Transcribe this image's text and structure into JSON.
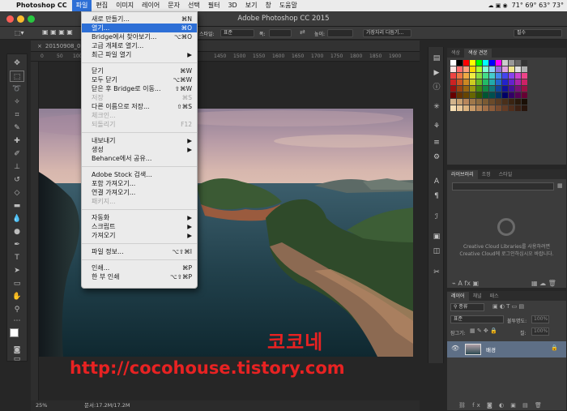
{
  "macbar": {
    "app_name": "Photoshop CC",
    "menus": [
      "파일",
      "편집",
      "이미지",
      "레이어",
      "문자",
      "선택",
      "필터",
      "3D",
      "보기",
      "창",
      "도움말"
    ],
    "status": "71°  69°  63°  73°"
  },
  "window": {
    "title": "Adobe Photoshop CC 2015"
  },
  "options": {
    "style_label": "스타일:",
    "style_value": "표준",
    "width_label": "폭:",
    "height_label": "높이:",
    "select_mask": "가장자리 다듬기...",
    "workspace": "필수"
  },
  "document": {
    "tab": "20150908_09",
    "ruler_ticks": [
      "0",
      "50",
      "100",
      "1450",
      "1500",
      "1550",
      "1600",
      "1650",
      "1700",
      "1750",
      "1800",
      "1850",
      "1900",
      "1950",
      "2000",
      "2050",
      "2100"
    ]
  },
  "statusbar": {
    "zoom": "25%",
    "doc_info": "문서:17.2M/17.2M"
  },
  "watermark": {
    "name": "코코네",
    "url": "http://cocohouse.tistory.com"
  },
  "swatches": {
    "tabs": [
      "색상",
      "색상 견본"
    ]
  },
  "libraries": {
    "tabs": [
      "라이브러리",
      "조정",
      "스타일"
    ],
    "message_line1": "Creative Cloud Libraries를 사용하려면",
    "message_line2": "Creative Cloud에 로그인하십시오 바랍니다."
  },
  "layers": {
    "tabs": [
      "레이어",
      "채널",
      "패스"
    ],
    "filter": "종류",
    "blend": "표준",
    "opacity_label": "불투명도:",
    "opacity": "100%",
    "lock_label": "잠그기:",
    "fill_label": "칠:",
    "fill": "100%",
    "layer_name": "배경"
  },
  "file_menu": {
    "items": [
      {
        "label": "새로 만들기...",
        "shortcut": "⌘N"
      },
      {
        "label": "열기...",
        "shortcut": "⌘O",
        "selected": true
      },
      {
        "label": "Bridge에서 찾아보기...",
        "shortcut": "⌥⌘O"
      },
      {
        "label": "고급 개체로 열기...",
        "shortcut": ""
      },
      {
        "label": "최근 파일 열기",
        "shortcut": "▶"
      },
      {
        "label": "닫기",
        "shortcut": "⌘W"
      },
      {
        "label": "모두 닫기",
        "shortcut": "⌥⌘W"
      },
      {
        "label": "닫은 후 Bridge로 이동...",
        "shortcut": "⇧⌘W"
      },
      {
        "label": "저장",
        "shortcut": "⌘S",
        "disabled": true
      },
      {
        "label": "다른 이름으로 저장...",
        "shortcut": "⇧⌘S"
      },
      {
        "label": "체크인...",
        "shortcut": "",
        "disabled": true
      },
      {
        "label": "되돌리기",
        "shortcut": "F12",
        "disabled": true
      },
      {
        "label": "내보내기",
        "shortcut": "▶"
      },
      {
        "label": "생성",
        "shortcut": "▶"
      },
      {
        "label": "Behance에서 공유...",
        "shortcut": ""
      },
      {
        "label": "Adobe Stock 검색...",
        "shortcut": ""
      },
      {
        "label": "포함 가져오기...",
        "shortcut": ""
      },
      {
        "label": "연결 가져오기...",
        "shortcut": ""
      },
      {
        "label": "패키지...",
        "shortcut": "",
        "disabled": true
      },
      {
        "label": "자동화",
        "shortcut": "▶"
      },
      {
        "label": "스크립트",
        "shortcut": "▶"
      },
      {
        "label": "가져오기",
        "shortcut": "▶"
      },
      {
        "label": "파일 정보...",
        "shortcut": "⌥⇧⌘I"
      },
      {
        "label": "인쇄...",
        "shortcut": "⌘P"
      },
      {
        "label": "한 부 인쇄",
        "shortcut": "⌥⇧⌘P"
      }
    ]
  }
}
